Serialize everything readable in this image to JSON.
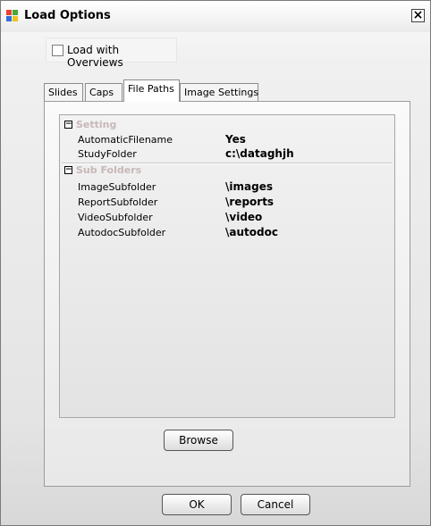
{
  "window": {
    "title": "Load Options"
  },
  "overview": {
    "checkbox_label": "Load with Overviews",
    "checked": false
  },
  "tabs": [
    {
      "label": "Slides",
      "active": false
    },
    {
      "label": "Caps",
      "active": false
    },
    {
      "label": "File Paths",
      "active": true
    },
    {
      "label": "Image Settings",
      "active": false
    }
  ],
  "grid": {
    "groups": [
      {
        "title": "Setting",
        "rows": [
          {
            "name": "AutomaticFilename",
            "value": "Yes"
          },
          {
            "name": "StudyFolder",
            "value": "c:\\dataghjh"
          }
        ]
      },
      {
        "title": "Sub Folders",
        "rows": [
          {
            "name": "ImageSubfolder",
            "value": "\\images"
          },
          {
            "name": "ReportSubfolder",
            "value": "\\reports"
          },
          {
            "name": "VideoSubfolder",
            "value": "\\video"
          },
          {
            "name": "AutodocSubfolder",
            "value": "\\autodoc"
          }
        ]
      }
    ]
  },
  "buttons": {
    "browse": "Browse",
    "ok": "OK",
    "cancel": "Cancel"
  },
  "icons": {
    "app": "windows-logo-icon",
    "close": "close-icon",
    "collapse": "minus-box-icon"
  },
  "colors": {
    "group_title": "#c8b8b8",
    "border": "#8c8c8c"
  }
}
